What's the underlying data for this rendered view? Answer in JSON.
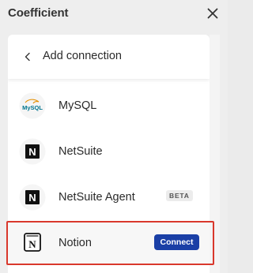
{
  "app": {
    "title": "Coefficient",
    "close_icon": "close-icon"
  },
  "panel": {
    "title": "Add connection",
    "back_icon": "chevron-left-icon"
  },
  "connections": [
    {
      "label": "MySQL",
      "logo": "mysql-logo",
      "logo_text": "MySQL"
    },
    {
      "label": "NetSuite",
      "logo": "netsuite-logo",
      "logo_text": "N"
    },
    {
      "label": "NetSuite Agent",
      "logo": "netsuite-logo",
      "logo_text": "N",
      "badge": "BETA"
    },
    {
      "label": "Notion",
      "logo": "notion-logo",
      "logo_text": "N",
      "action": "Connect",
      "selected": true
    }
  ],
  "colors": {
    "highlight_border": "#d9382c",
    "connect_button": "#1a3fa6"
  }
}
